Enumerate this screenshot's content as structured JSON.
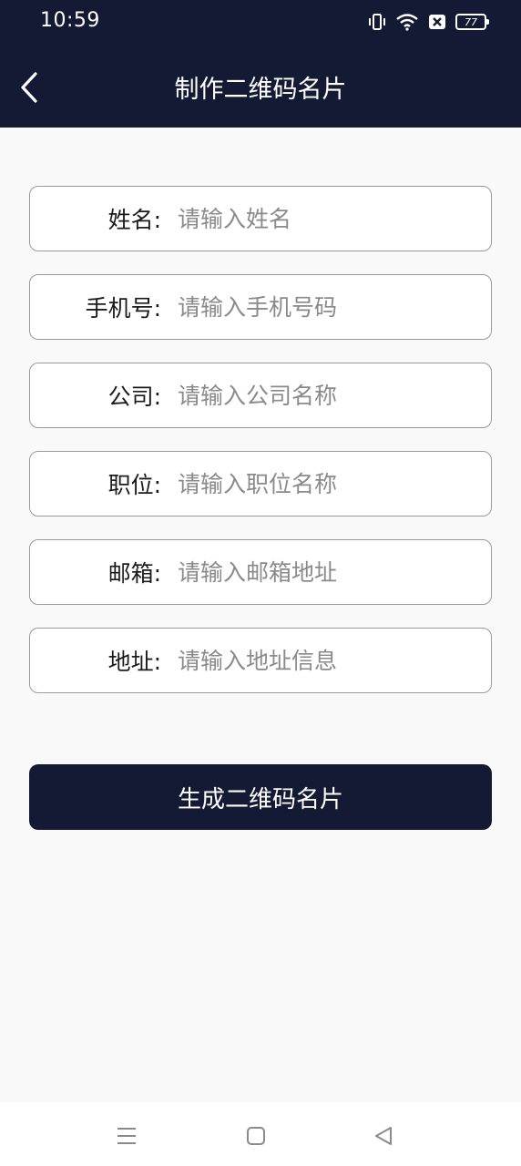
{
  "status_bar": {
    "time": "10:59",
    "battery_level": "77"
  },
  "app_bar": {
    "title": "制作二维码名片"
  },
  "form": {
    "fields": [
      {
        "label": "姓名:",
        "placeholder": "请输入姓名"
      },
      {
        "label": "手机号:",
        "placeholder": "请输入手机号码"
      },
      {
        "label": "公司:",
        "placeholder": "请输入公司名称"
      },
      {
        "label": "职位:",
        "placeholder": "请输入职位名称"
      },
      {
        "label": "邮箱:",
        "placeholder": "请输入邮箱地址"
      },
      {
        "label": "地址:",
        "placeholder": "请输入地址信息"
      }
    ],
    "submit_label": "生成二维码名片"
  },
  "colors": {
    "header_bg": "#151a34",
    "page_bg": "#f9f9f9",
    "field_border": "#9a9a9a",
    "placeholder": "#8a8a8a"
  }
}
